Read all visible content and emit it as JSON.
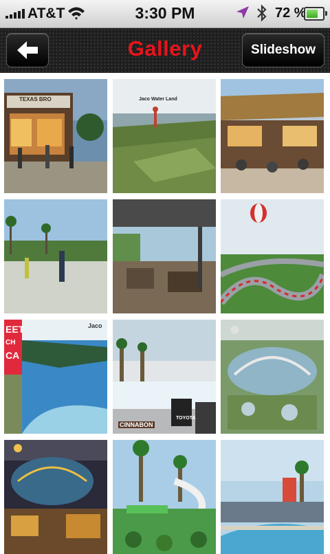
{
  "status_bar": {
    "carrier": "AT&T",
    "time": "3:30 PM",
    "battery_pct": "72 %",
    "battery_level": 0.72,
    "icons": [
      "signal-icon",
      "wifi-icon",
      "location-icon",
      "bluetooth-icon",
      "battery-icon"
    ]
  },
  "nav": {
    "title": "Gallery",
    "back_icon": "arrow-left-icon",
    "slideshow_label": "Slideshow",
    "title_color": "#e8141a"
  },
  "gallery": {
    "thumb_captions": {
      "texas": "TEXAS BRO",
      "jaco_water_land": "Jaco Water Land",
      "jaco": "Jaco",
      "sign_left": "EET",
      "sign_left2": "CH",
      "sign_left3": "CA",
      "cinnabon": "CINNABON",
      "toyota": "TOYOTA"
    }
  }
}
